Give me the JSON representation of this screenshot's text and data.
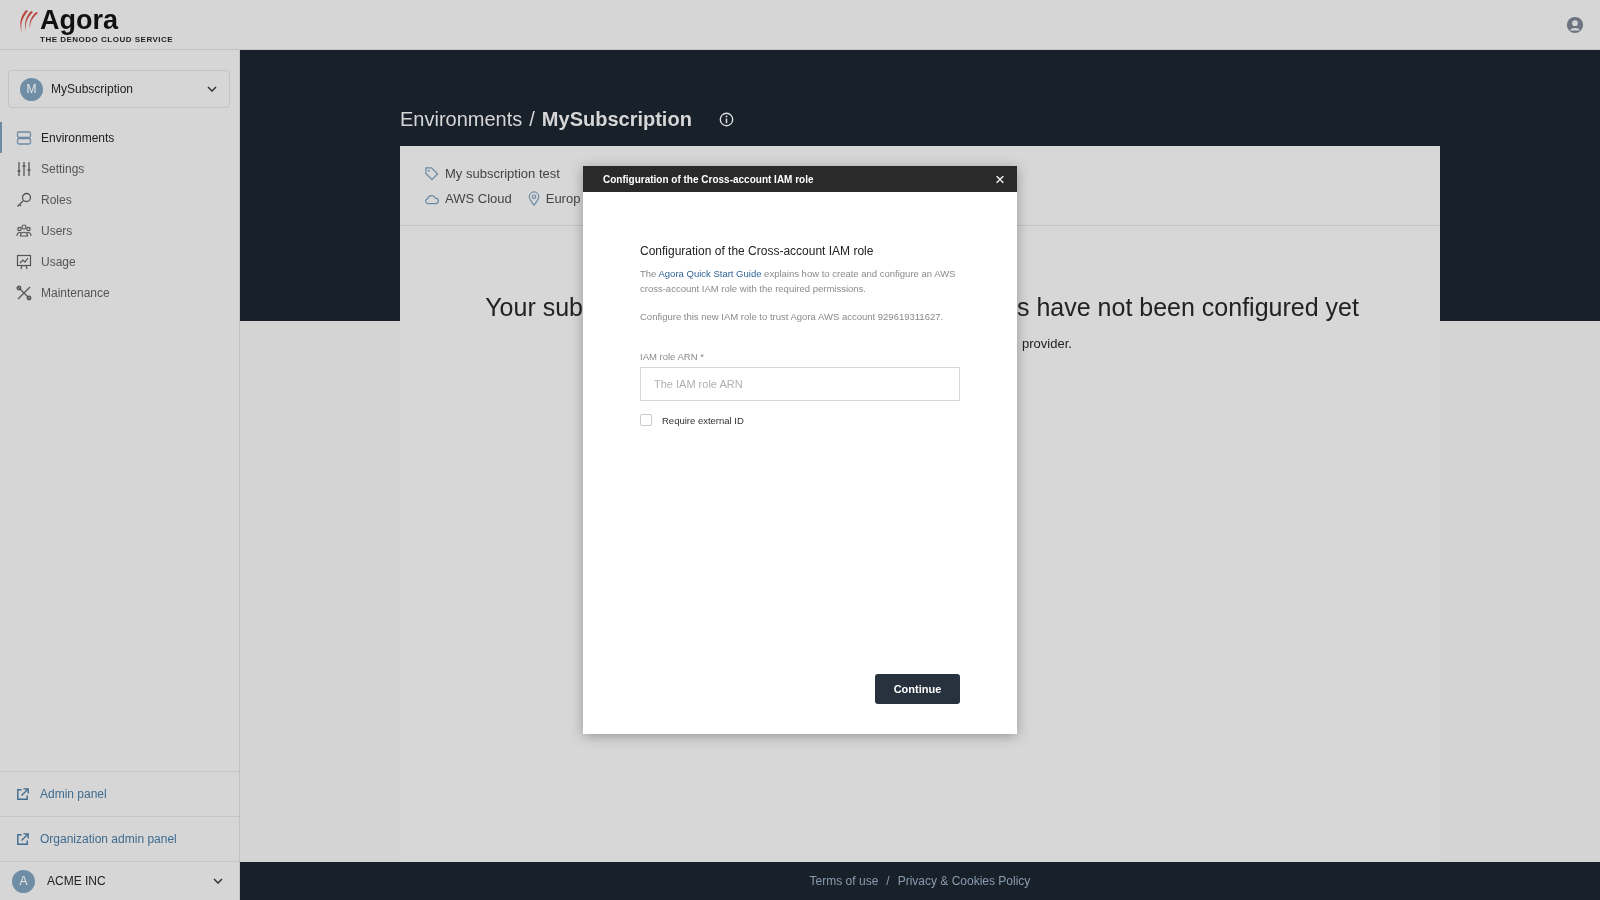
{
  "header": {
    "logo": "Agora",
    "tagline": "THE DENODO CLOUD SERVICE"
  },
  "sidebar": {
    "subscription": {
      "initial": "M",
      "name": "MySubscription"
    },
    "items": [
      {
        "label": "Environments",
        "selected": true
      },
      {
        "label": "Settings",
        "selected": false
      },
      {
        "label": "Roles",
        "selected": false
      },
      {
        "label": "Users",
        "selected": false
      },
      {
        "label": "Usage",
        "selected": false
      },
      {
        "label": "Maintenance",
        "selected": false
      }
    ],
    "links": [
      "Admin panel",
      "Organization admin panel"
    ],
    "organization": {
      "initial": "A",
      "name": "ACME INC"
    }
  },
  "breadcrumb": {
    "parent": "Environments",
    "separator": "/",
    "current": "MySubscription"
  },
  "subscription_card": {
    "name": "My subscription test",
    "provider": "AWS Cloud",
    "region": "Europ",
    "headline_left": "Your sub",
    "headline_right": "s have not been configured yet",
    "note_right": "provider."
  },
  "dialog": {
    "title": "Configuration of the Cross-account IAM role",
    "close": "×",
    "heading": "Configuration of the Cross-account IAM role",
    "intro_before": "The",
    "intro_link": "Agora Quick Start Guide",
    "intro_after": "explains how to create and configure an AWS cross-account IAM role with the required permissions.",
    "trust_note": "Configure this new IAM role to trust Agora AWS account 929619311627.",
    "field_label": "IAM role ARN *",
    "field_placeholder": "The IAM role ARN",
    "checkbox": {
      "label": "Require external ID",
      "checked": false
    },
    "button": "Continue"
  },
  "footer": {
    "links": [
      "Terms of use",
      "Privacy & Cookies Policy"
    ],
    "separator": "/"
  }
}
